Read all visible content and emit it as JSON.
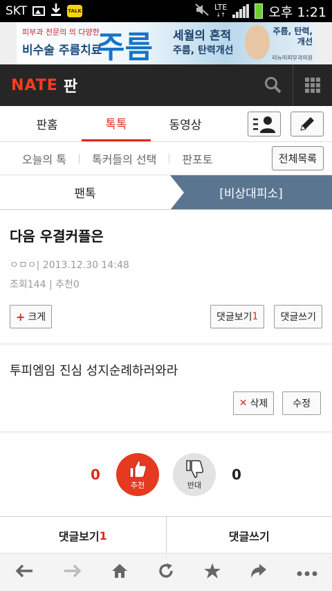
{
  "status_bar": {
    "carrier": "SKT",
    "talk_badge": "TALK",
    "network": "LTE",
    "time": "오후 1:21"
  },
  "ad": {
    "small_line": "피부과 전문의 의 다양한",
    "left_text": "비수술 주름치료",
    "big_text": "주름",
    "sub1": "세월의 흔적",
    "sub2": "주름, 탄력개선",
    "right_text": "주름, 탄력, 개선",
    "clinic": "리뉴미피부과의원"
  },
  "header": {
    "logo": "NATE",
    "section": "판"
  },
  "tabs": [
    "판홈",
    "톡톡",
    "동영상"
  ],
  "subtabs": [
    "오늘의 톡",
    "톡커들의 선택",
    "판포토"
  ],
  "all_list_label": "전체목록",
  "category": {
    "left": "팬톡",
    "right": "[비상대피소]"
  },
  "post": {
    "title": "다음 우결커플은",
    "author": "ㅇㅁㅇ",
    "date": "2013.12.30 14:48",
    "views_label": "조회",
    "views": "144",
    "recommend_label": "추천",
    "recommend": "0",
    "enlarge_label": "크게",
    "comments_view_label": "댓글보기",
    "comments_count": "1",
    "comment_write_label": "댓글쓰기",
    "body": "투피엠임 진심 성지순례하러와라",
    "delete_label": "삭제",
    "edit_label": "수정"
  },
  "vote": {
    "up_count": "0",
    "up_label": "추천",
    "down_label": "반대",
    "down_count": "0"
  },
  "bottom": {
    "view_comments": "댓글보기",
    "comments_count": "1",
    "write_comment": "댓글쓰기"
  },
  "colors": {
    "accent": "#e0291b",
    "category_bg": "#5a7590",
    "header_bg": "#262626"
  }
}
